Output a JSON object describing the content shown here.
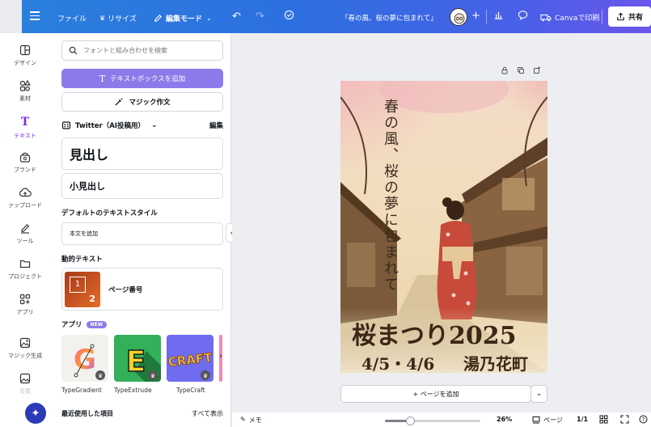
{
  "topbar": {
    "file": "ファイル",
    "resize": "リサイズ",
    "edit_mode": "編集モード",
    "doc_title": "「春の風、桜の夢に包まれて」",
    "print": "Canvaで印刷",
    "share": "共有"
  },
  "rail": {
    "items": [
      {
        "label": "デザイン",
        "icon": "layout-icon"
      },
      {
        "label": "素材",
        "icon": "elements-icon"
      },
      {
        "label": "テキスト",
        "icon": "text-icon"
      },
      {
        "label": "ブランド",
        "icon": "brand-icon"
      },
      {
        "label": "ァップロード",
        "icon": "upload-icon"
      },
      {
        "label": "ツール",
        "icon": "draw-icon"
      },
      {
        "label": "プロジェクト",
        "icon": "folder-icon"
      },
      {
        "label": "アプリ",
        "icon": "apps-icon"
      },
      {
        "label": "マジック生成",
        "icon": "magic-media-icon"
      },
      {
        "label": "写真",
        "icon": "photo-icon"
      }
    ]
  },
  "panel": {
    "search_placeholder": "フォントと組み合わせを検索",
    "add_textbox": "テキストボックスを追加",
    "magic_write": "マジック作文",
    "brand_kit": "Twitter（AI投稿用）",
    "edit": "編集",
    "heading": "見出し",
    "subheading": "小見出し",
    "default_styles": "デフォルトのテキストスタイル",
    "body_text": "本文を追加",
    "dynamic_text": "動的テキスト",
    "page_number": "ページ番号",
    "page_thumb_1": "1",
    "page_thumb_2": "2",
    "apps": "アプリ",
    "new_badge": "NEW",
    "app_cards": [
      {
        "name": "TypeGradient"
      },
      {
        "name": "TypeExtrude"
      },
      {
        "name": "TypeCraft"
      }
    ],
    "recent": "最近使用した項目",
    "show_all": "すべて表示"
  },
  "poster": {
    "vertical_text": "春の風、桜の夢に包まれて",
    "title": "桜まつり2025",
    "dates": "4/5・4/6",
    "place": "湯乃花町"
  },
  "canvas": {
    "add_page": "+ ページを追加"
  },
  "bottombar": {
    "memo": "メモ",
    "zoom": "26%",
    "zoom_fraction": 0.26,
    "pages": "ページ",
    "page_count": "1/1"
  },
  "colors": {
    "topbar_start": "#2a7fdc",
    "topbar_end": "#6a56ea",
    "accent_purple": "#8b7bea",
    "active_rail": "#7d2ae8"
  }
}
